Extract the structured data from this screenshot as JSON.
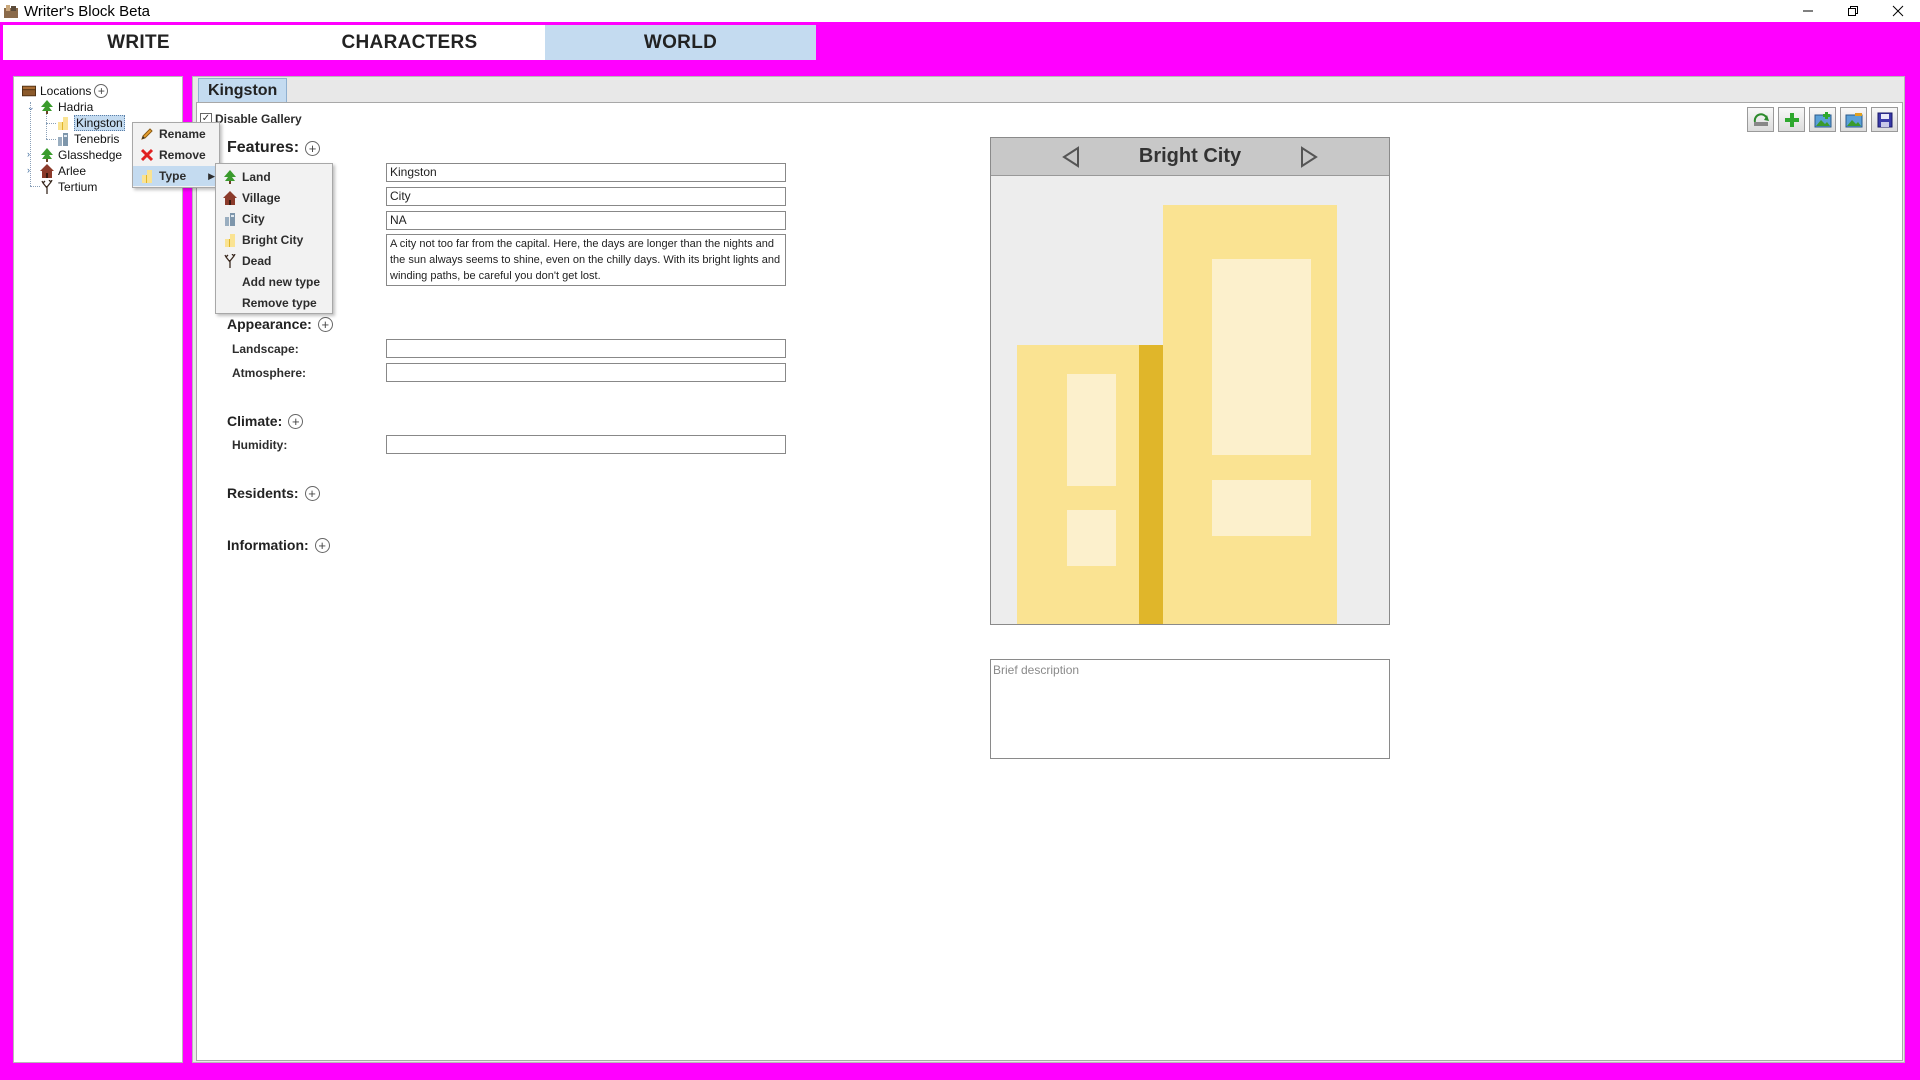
{
  "window": {
    "title": "Writer's Block Beta",
    "controls": [
      "minimize",
      "restore",
      "close"
    ]
  },
  "main_tabs": [
    {
      "label": "WRITE",
      "active": false
    },
    {
      "label": "CHARACTERS",
      "active": false
    },
    {
      "label": "WORLD",
      "active": true
    }
  ],
  "tree": {
    "root": "Locations",
    "nodes": [
      {
        "label": "Hadria",
        "icon": "tree-icon"
      },
      {
        "label": "Kingston",
        "icon": "bright-city-icon",
        "selected": true
      },
      {
        "label": "Tenebris",
        "icon": "city-icon"
      },
      {
        "label": "Glasshedge",
        "icon": "tree-icon"
      },
      {
        "label": "Arlee",
        "icon": "house-icon"
      },
      {
        "label": "Tertium",
        "icon": "dead-tree-icon"
      }
    ]
  },
  "context_menu": {
    "items": [
      {
        "label": "Rename",
        "icon": "pencil-icon"
      },
      {
        "label": "Remove",
        "icon": "x-icon"
      },
      {
        "label": "Type",
        "icon": "bright-city-icon",
        "highlighted": true
      }
    ]
  },
  "type_submenu": {
    "items": [
      {
        "label": "Land",
        "icon": "tree-icon"
      },
      {
        "label": "Village",
        "icon": "house-icon"
      },
      {
        "label": "City",
        "icon": "city-icon"
      },
      {
        "label": "Bright City",
        "icon": "bright-city-icon"
      },
      {
        "label": "Dead",
        "icon": "dead-tree-icon"
      },
      {
        "label": "Add new type"
      },
      {
        "label": "Remove type"
      }
    ]
  },
  "doc_tab": {
    "label": "Kingston"
  },
  "gallery_toggle": {
    "label": "Disable Gallery",
    "checked": true
  },
  "sections": {
    "features": "Features:",
    "appearance": "Appearance:",
    "climate": "Climate:",
    "residents": "Residents:",
    "information": "Information:"
  },
  "features": {
    "name": "Kingston",
    "type": "City",
    "third": "NA",
    "description": "A city not too far from the capital. Here, the days are longer than the nights and the sun always seems to shine, even on the chilly days. With its bright lights and winding paths, be careful you don't get lost."
  },
  "appearance": {
    "landscape_label": "Landscape:",
    "landscape_value": "",
    "atmosphere_label": "Atmosphere:",
    "atmosphere_value": ""
  },
  "climate": {
    "humidity_label": "Humidity:",
    "humidity_value": ""
  },
  "gallery": {
    "title": "Bright City",
    "image": "bright-city-illustration"
  },
  "brief_description": {
    "placeholder": "Brief description"
  },
  "toolbar": [
    "refresh-icon",
    "add-icon",
    "image-add-icon",
    "image-edit-icon",
    "save-icon"
  ],
  "colors": {
    "background": "#ff00ff",
    "active_tab": "#c4dbf0",
    "building_main": "#fae392",
    "building_accent": "#e0b62a",
    "window": "#fcf0cc"
  }
}
